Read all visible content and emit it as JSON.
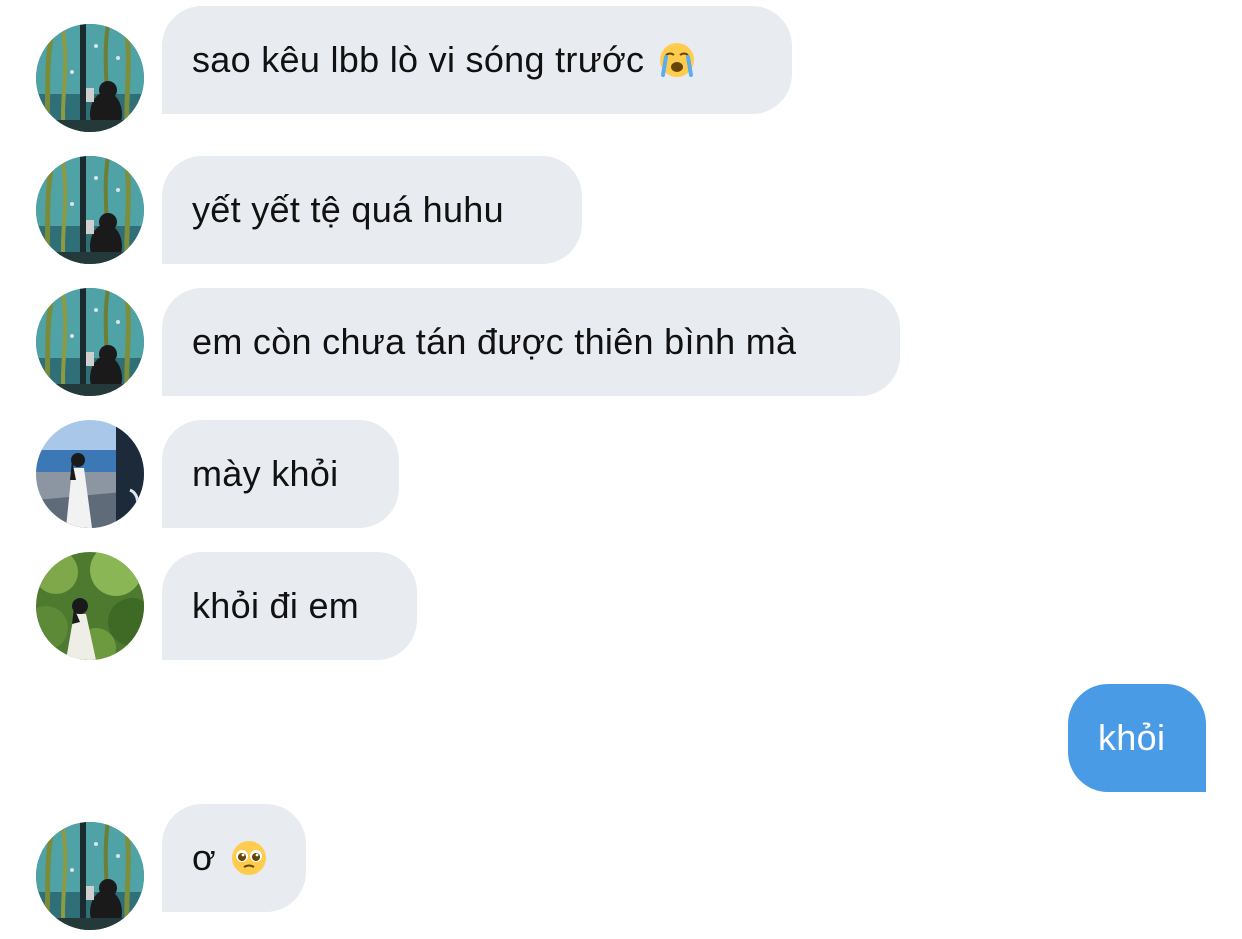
{
  "conversation": {
    "messages": [
      {
        "sender": "other",
        "avatar": "aquarium-avatar",
        "text": "sao kêu lbb lò vi sóng trước",
        "emoji": "loudly-crying-face-emoji"
      },
      {
        "sender": "other",
        "avatar": "aquarium-avatar",
        "text": "yết yết tệ quá huhu"
      },
      {
        "sender": "other",
        "avatar": "aquarium-avatar",
        "text": "em còn chưa tán được thiên bình mà"
      },
      {
        "sender": "other",
        "avatar": "seaside-girl-avatar",
        "text": "mày khỏi"
      },
      {
        "sender": "other",
        "avatar": "forest-girl-avatar",
        "text": "khỏi đi em"
      },
      {
        "sender": "me",
        "text": "khỏi"
      },
      {
        "sender": "other",
        "avatar": "aquarium-avatar",
        "text": "ơ",
        "emoji": "pleading-face-emoji"
      }
    ]
  },
  "colors": {
    "incoming_bubble": "#e8ebf0",
    "outgoing_bubble": "#4a9be6",
    "incoming_text": "#111111",
    "outgoing_text": "#ffffff"
  }
}
